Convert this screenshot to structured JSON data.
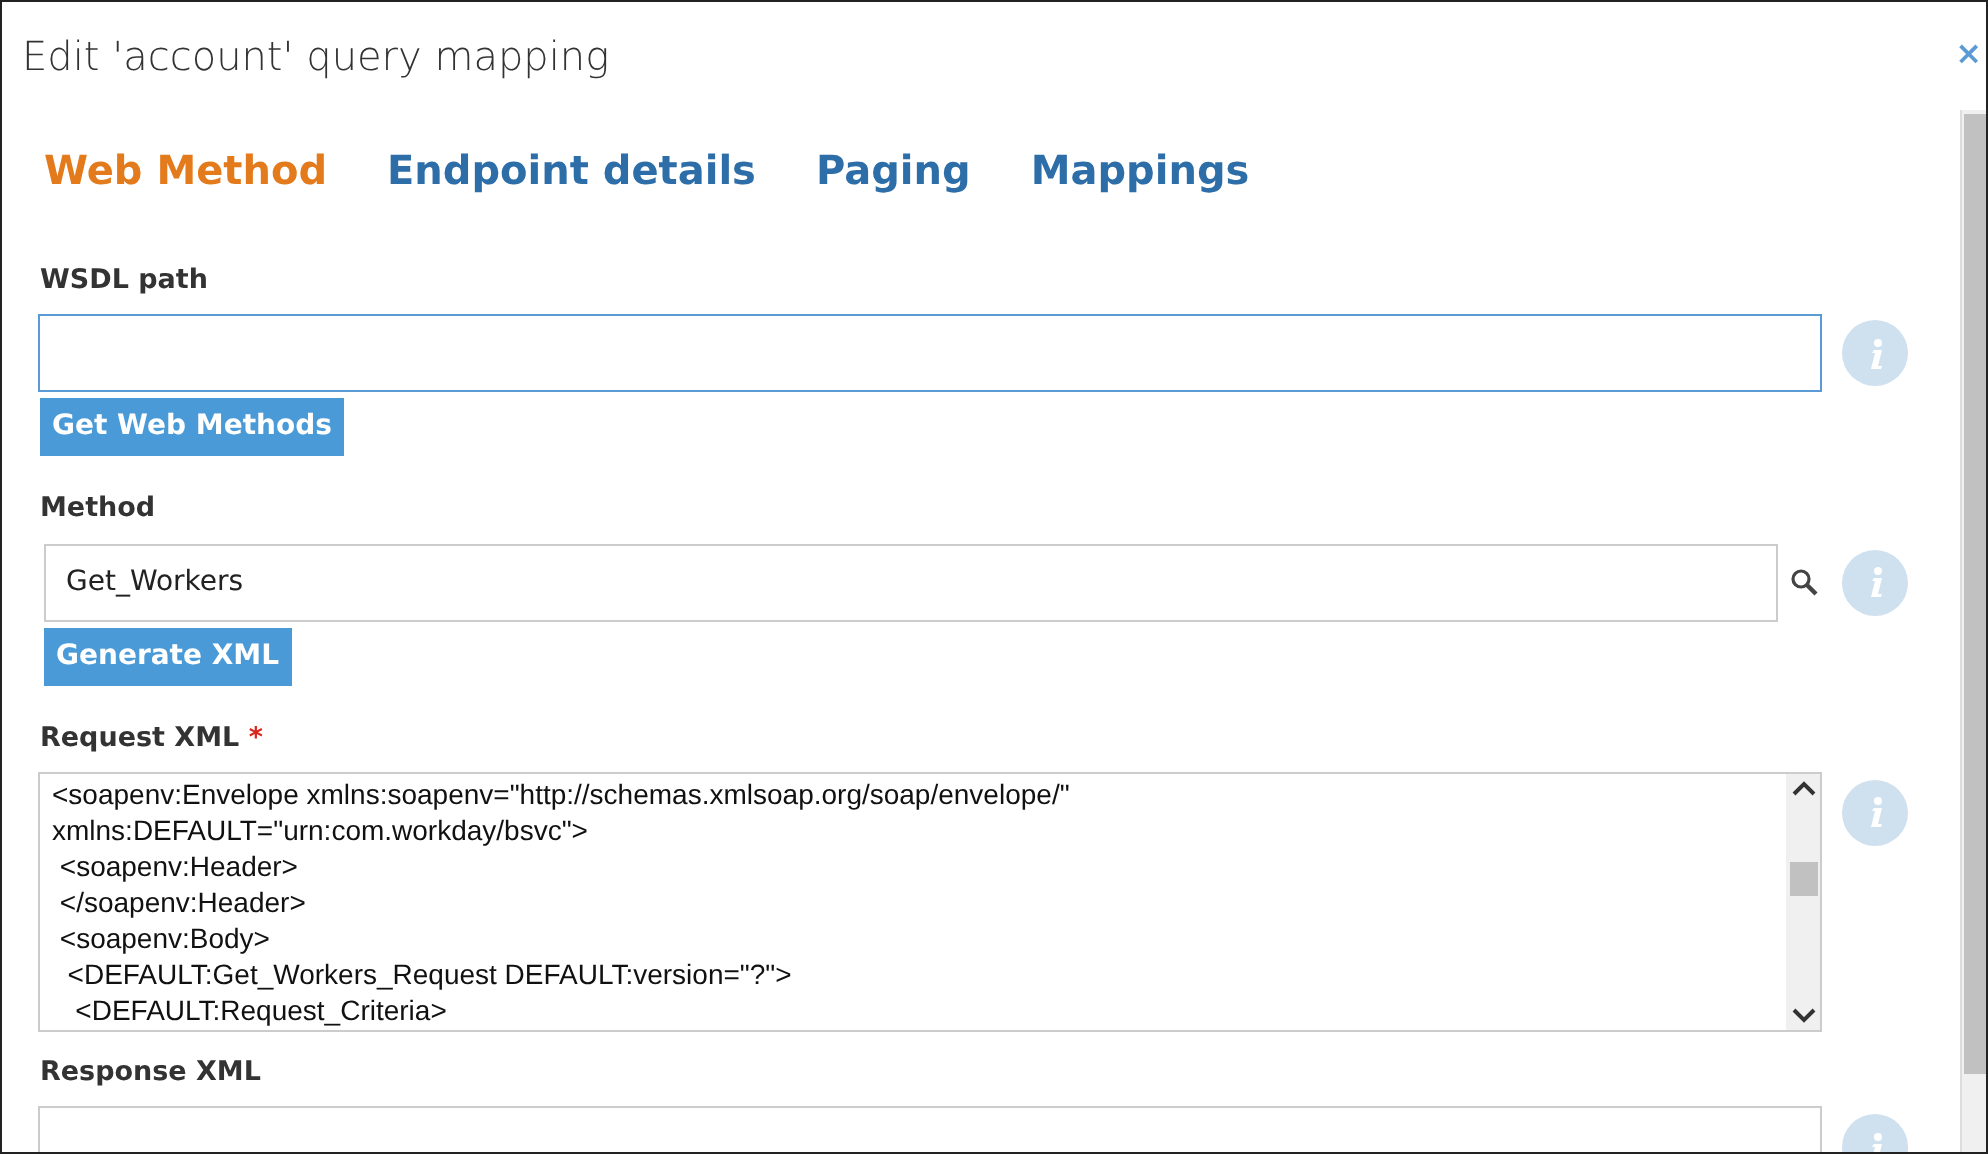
{
  "dialog": {
    "title": "Edit 'account' query mapping",
    "close": "×"
  },
  "tabs": [
    {
      "label": "Web Method",
      "selected": true
    },
    {
      "label": "Endpoint details",
      "selected": false
    },
    {
      "label": "Paging",
      "selected": false
    },
    {
      "label": "Mappings",
      "selected": false
    }
  ],
  "wsdl": {
    "label": "WSDL path",
    "focused": true,
    "button": "Get Web Methods"
  },
  "method": {
    "label": "Method",
    "value": "Get_Workers",
    "button": "Generate XML"
  },
  "request_xml": {
    "label": "Request XML",
    "required_marker": "*",
    "lines": [
      "<soapenv:Envelope xmlns:soapenv=\"http://schemas.xmlsoap.org/soap/envelope/\"",
      "xmlns:DEFAULT=\"urn:com.workday/bsvc\">",
      " <soapenv:Header>",
      " </soapenv:Header>",
      " <soapenv:Body>",
      "  <DEFAULT:Get_Workers_Request DEFAULT:version=\"?\">",
      "   <DEFAULT:Request_Criteria>"
    ]
  },
  "response_xml": {
    "label": "Response XML"
  }
}
